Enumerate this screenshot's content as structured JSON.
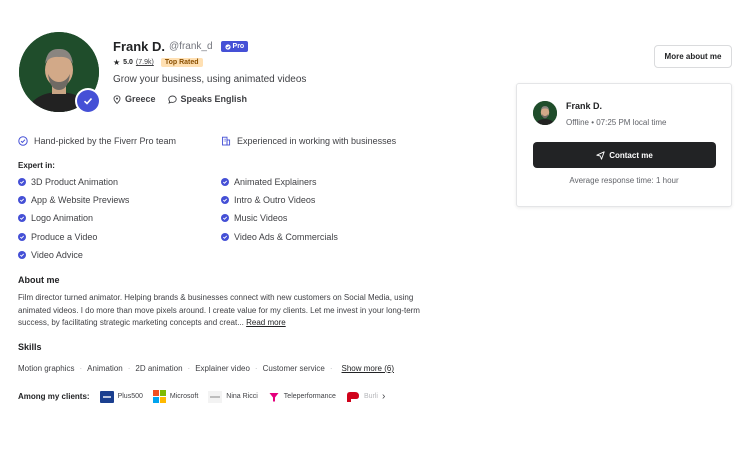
{
  "profile": {
    "name": "Frank D.",
    "username": "@frank_d",
    "pro_label": "Pro",
    "rating": "5.0",
    "review_count": "(7.9k)",
    "top_rated_label": "Top Rated",
    "tagline": "Grow your business, using animated videos",
    "location": "Greece",
    "languages": "Speaks English"
  },
  "features": {
    "handpicked": "Hand-picked by the Fiverr Pro team",
    "experienced": "Experienced in working with businesses"
  },
  "expert": {
    "title": "Expert in:",
    "left": [
      "3D Product Animation",
      "App & Website Previews",
      "Logo Animation",
      "Produce a Video",
      "Video Advice"
    ],
    "right": [
      "Animated Explainers",
      "Intro & Outro Videos",
      "Music Videos",
      "Video Ads & Commercials"
    ]
  },
  "about": {
    "title": "About me",
    "text": "Film director turned animator. Helping brands & businesses connect with new customers on Social Media, using animated videos. I do more than move pixels around. I create value for my clients. Let me invest in your long-term success, by facilitating strategic marketing concepts and creat...",
    "read_more": "Read more"
  },
  "skills": {
    "title": "Skills",
    "items": [
      "Motion graphics",
      "Animation",
      "2D animation",
      "Explainer video",
      "Customer service"
    ],
    "show_more": "Show more (6)"
  },
  "clients": {
    "label": "Among my clients:",
    "items": [
      "Plus500",
      "Microsoft",
      "Nina Ricci",
      "Teleperformance",
      "Burli"
    ]
  },
  "contact": {
    "more_about_label": "More about me",
    "name": "Frank D.",
    "status": "Offline • 07:25 PM local time",
    "contact_label": "Contact me",
    "response_time": "Average response time: 1 hour"
  },
  "colors": {
    "pro_accent": "#4550d6",
    "top_rated_bg": "#ffe0b3",
    "contact_button": "#222325"
  },
  "icons": [
    "verified-icon",
    "star-icon",
    "location-icon",
    "chat-icon",
    "shield-check-icon",
    "building-icon",
    "check-icon",
    "send-icon",
    "chevron-right-icon"
  ]
}
